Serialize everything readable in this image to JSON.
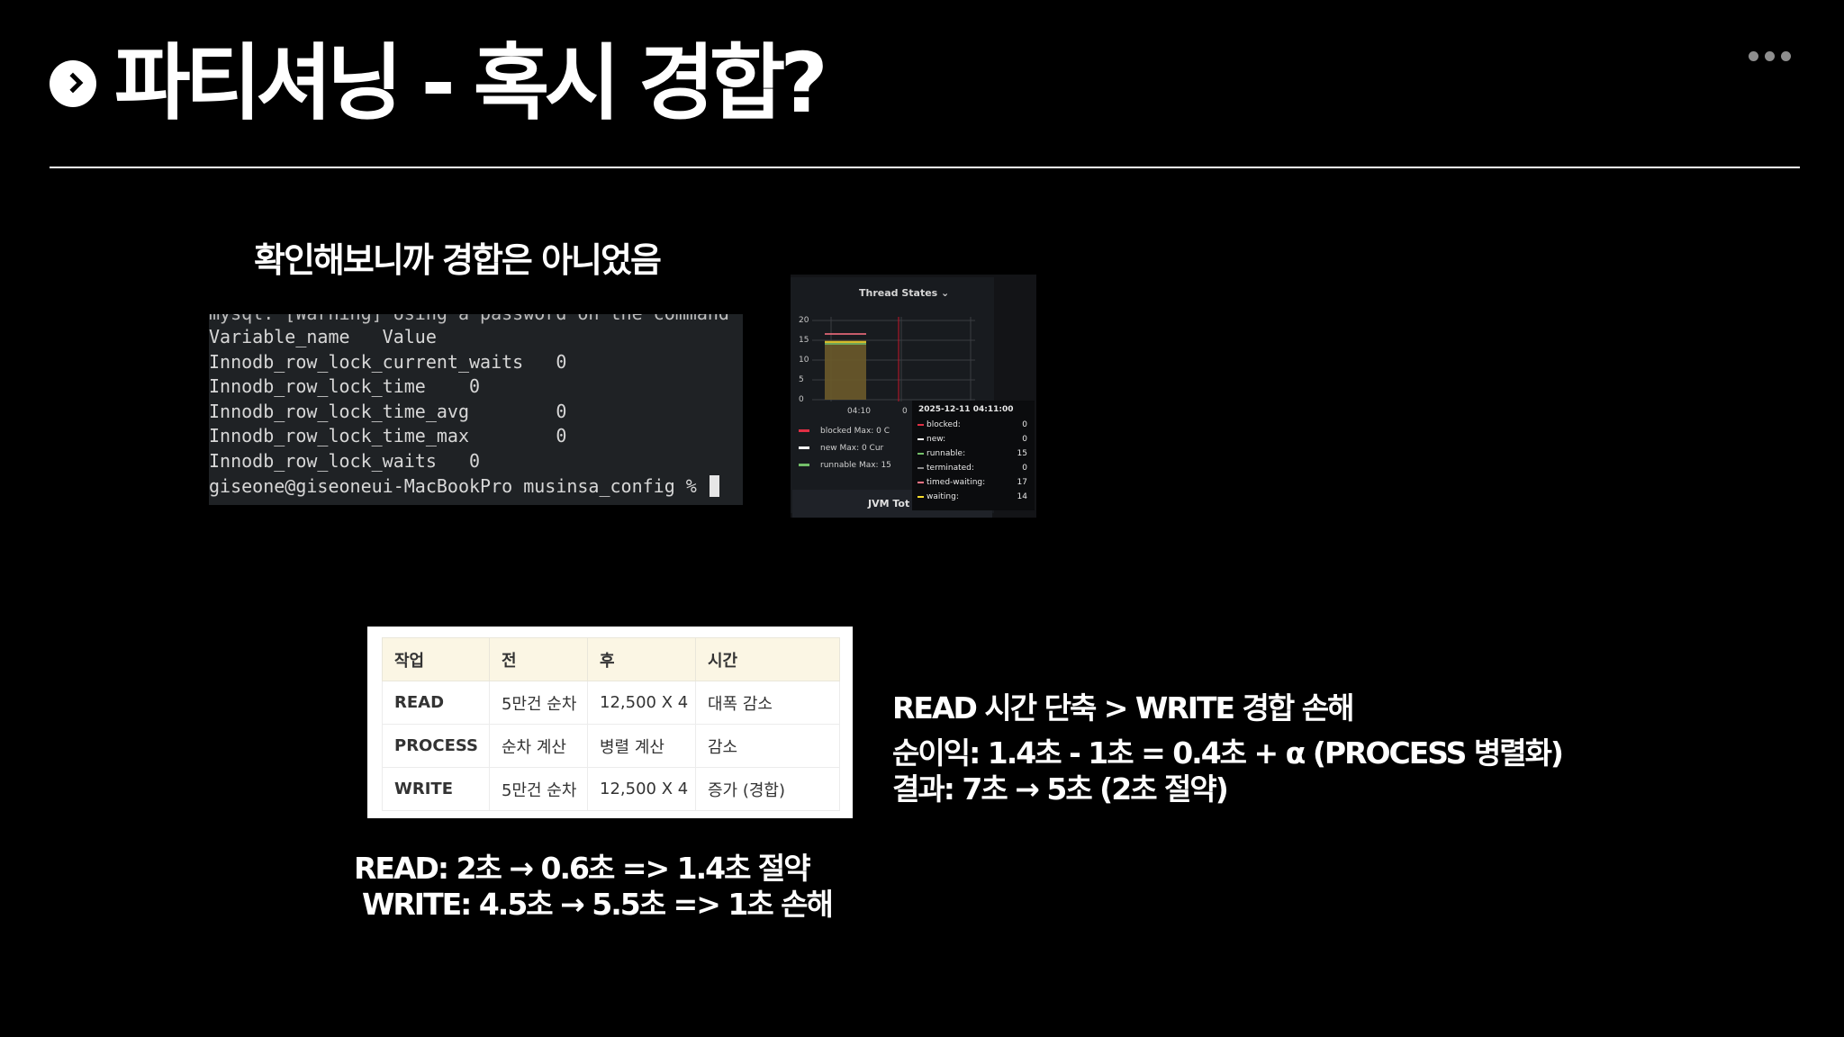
{
  "slide": {
    "title": "파티셔닝 - 혹시 경합?",
    "subtitle": "확인해보니까 경합은 아니었음"
  },
  "terminal": {
    "cut_line": "mysql: [Warning] Using a password on the command",
    "lines": [
      "Variable_name   Value",
      "Innodb_row_lock_current_waits   0",
      "Innodb_row_lock_time    0",
      "Innodb_row_lock_time_avg        0",
      "Innodb_row_lock_time_max        0",
      "Innodb_row_lock_waits   0",
      "giseone@giseoneui-MacBookPro musinsa_config %"
    ]
  },
  "grafana": {
    "title": "Thread States ⌄",
    "y_ticks": [
      "20",
      "15",
      "10",
      "5",
      "0"
    ],
    "x_ticks": [
      "04:10",
      "0"
    ],
    "legend": [
      {
        "label": "blocked   Max: 0  C",
        "color": "#e02f44"
      },
      {
        "label": "new     Max: 0  Cur",
        "color": "#ffffff"
      },
      {
        "label": "runnable    Max: 15",
        "color": "#73bf69"
      }
    ],
    "bottom_panel": "JVM Tot",
    "tooltip": {
      "time": "2025-12-11 04:11:00",
      "rows": [
        {
          "label": "blocked:",
          "value": "0",
          "color": "#e02f44"
        },
        {
          "label": "new:",
          "value": "0",
          "color": "#ffffff"
        },
        {
          "label": "runnable:",
          "value": "15",
          "color": "#73bf69"
        },
        {
          "label": "terminated:",
          "value": "0",
          "color": "#8a8a8a"
        },
        {
          "label": "timed-waiting:",
          "value": "17",
          "color": "#ff7383"
        },
        {
          "label": "waiting:",
          "value": "14",
          "color": "#fade2a"
        }
      ]
    }
  },
  "table": {
    "headers": [
      "작업",
      "전",
      "후",
      "시간"
    ],
    "rows": [
      [
        "READ",
        "5만건 순차",
        "12,500 X 4",
        "대폭 감소"
      ],
      [
        "PROCESS",
        "순차 계산",
        "병렬 계산",
        "감소"
      ],
      [
        "WRITE",
        "5만건 순차",
        "12,500 X 4",
        "증가 (경합)"
      ]
    ]
  },
  "notes": {
    "read": "READ: 2초 → 0.6초  => 1.4초 절약",
    "write": "WRITE: 4.5초 → 5.5초 =>  1초 손해",
    "summary1": "READ 시간 단축 > WRITE 경합 손해",
    "summary2": "순이익: 1.4초 - 1초 = 0.4초 + α (PROCESS 병렬화)",
    "summary3": "결과: 7초 → 5초 (2초 절약)"
  }
}
